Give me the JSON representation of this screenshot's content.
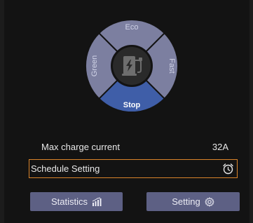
{
  "mode_dial": {
    "top_label": "Eco",
    "left_label": "Green",
    "right_label": "Fast",
    "bottom_label": "Stop",
    "center_icon": "ev-charger-icon",
    "selected": "Stop"
  },
  "charge": {
    "label": "Max charge current",
    "value": "32A"
  },
  "schedule": {
    "label": "Schedule Setting",
    "icon": "alarm-clock-icon"
  },
  "buttons": {
    "statistics_label": "Statistics",
    "statistics_icon": "bar-chart-icon",
    "setting_label": "Setting",
    "setting_icon": "gear-icon"
  },
  "colors": {
    "segment": "#7c7fa0",
    "selected_segment": "#3f5ea8",
    "button": "#5d6084",
    "highlight_border": "#d9832a"
  }
}
